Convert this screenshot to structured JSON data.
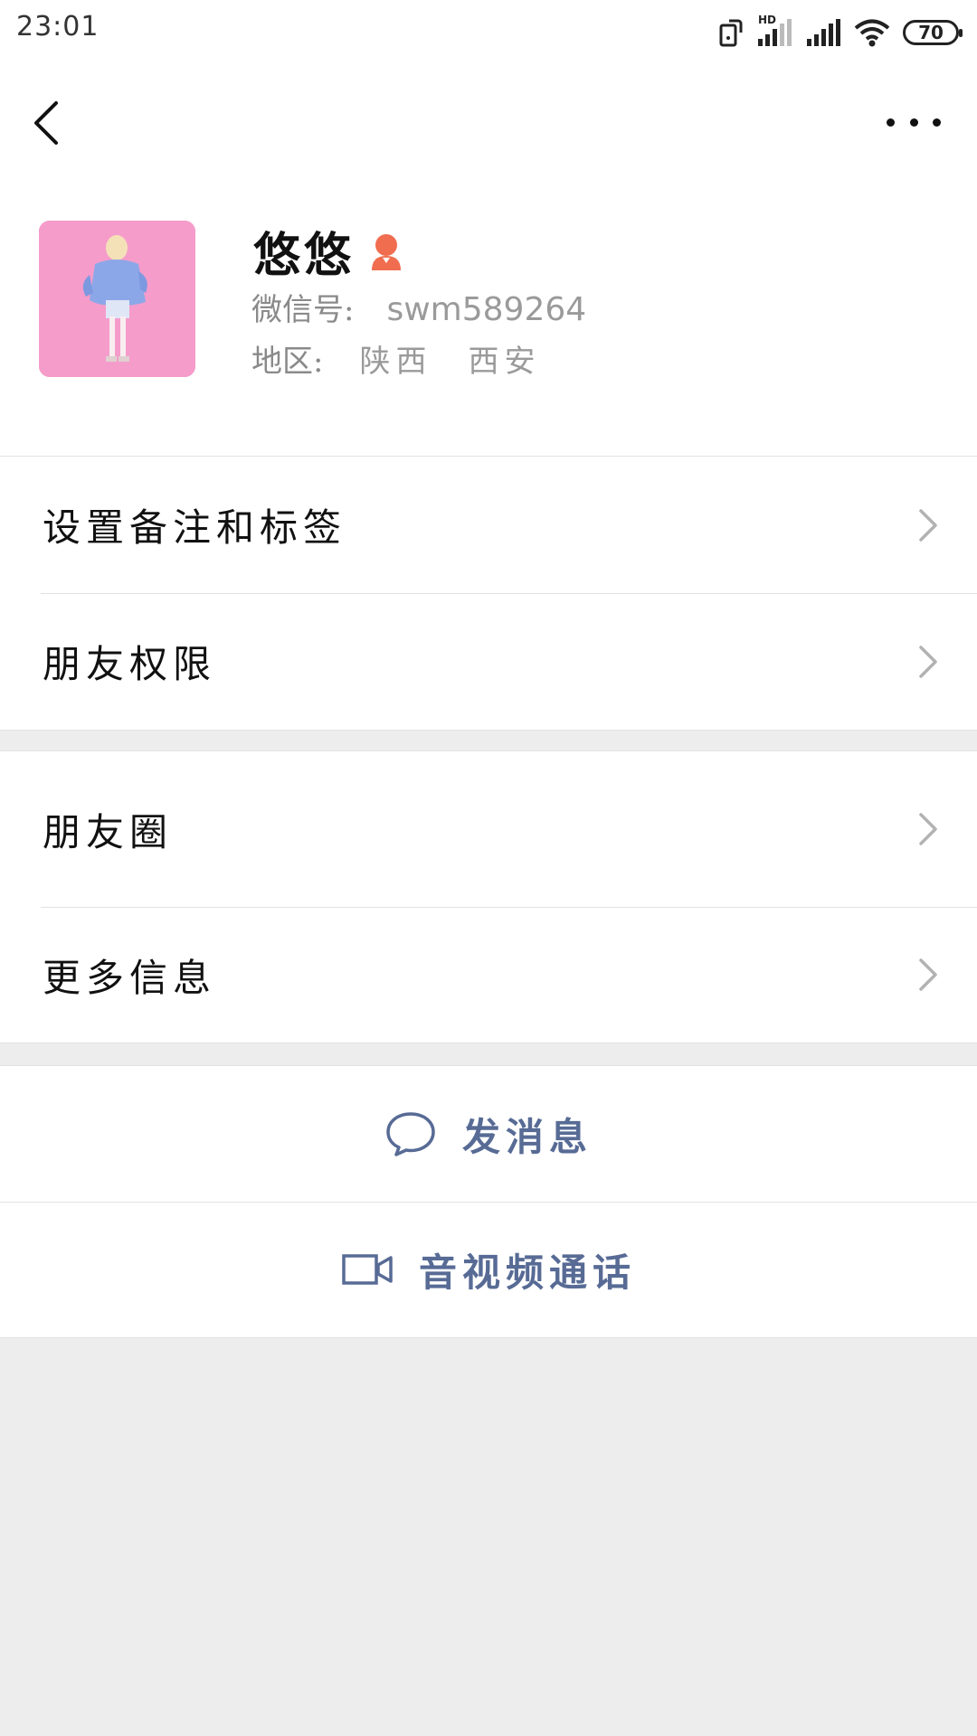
{
  "status_bar": {
    "time": "23:01",
    "battery": "70",
    "network_badge": "HD"
  },
  "nav": {
    "back_icon": "chevron-left-icon",
    "more_icon": "more-dots-icon"
  },
  "profile": {
    "name": "悠悠",
    "gender_icon": "female-icon",
    "gender_color": "#f06d4f",
    "wechat_id_label": "微信号:",
    "wechat_id": "swm589264",
    "region_label": "地区:",
    "region_province": "陕西",
    "region_city": "西安"
  },
  "menu": {
    "group1": [
      {
        "label": "设置备注和标签"
      },
      {
        "label": "朋友权限"
      }
    ],
    "group2": [
      {
        "label": "朋友圈"
      },
      {
        "label": "更多信息"
      }
    ]
  },
  "actions": {
    "send_message": "发消息",
    "video_call": "音视频通话",
    "accent_color": "#576b95"
  }
}
